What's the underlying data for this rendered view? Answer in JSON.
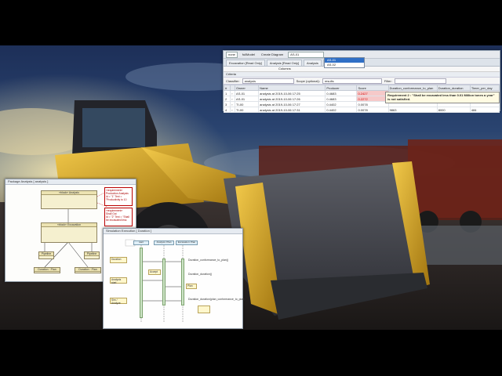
{
  "toolbar": {
    "select_value": "none",
    "label_fullmodel": "fullModel",
    "label_create_diagram": "Create Diagram",
    "search_value": "AS-01",
    "dropdown_items": [
      "AS-01",
      "AS-02"
    ]
  },
  "tabs": [
    {
      "label": "Excavation [Read Only]"
    },
    {
      "label": "Analysis [Read Only]"
    },
    {
      "label": "Analysis"
    },
    {
      "label": "results"
    }
  ],
  "subtoolbar_label": "Columns",
  "section_label": "Criteria",
  "filters": {
    "classifier_label": "Classifier:",
    "classifier_value": "analysis",
    "scope_label": "Scope (optional):",
    "scope_value": "results",
    "filter_label": "Filter:"
  },
  "table": {
    "columns": [
      "#",
      "",
      "Owner",
      "Name",
      "Producer",
      "Score",
      "Duration_conformance_to_plan",
      "Duration_duration",
      "Timer_per_day"
    ],
    "rows": [
      {
        "num": "1",
        "owner": "AS-01",
        "name": "analysis at 2019-10-06 17:25",
        "producer": "0.4683",
        "score": "0.2427",
        "duration_plan": "4993",
        "duration": "5917",
        "timer": "484"
      },
      {
        "num": "2",
        "owner": "AS-01",
        "name": "analysis at 2019-10-06 17:26",
        "producer": "0.4683",
        "score": "0.2272",
        "duration_plan": "",
        "duration": "",
        "timer": ""
      },
      {
        "num": "3",
        "owner": "TI-00",
        "name": "analysis at 2019-10-06 17:27",
        "producer": "0.4402",
        "score": "0.0078",
        "duration_plan": "",
        "duration": "",
        "timer": ""
      },
      {
        "num": "4",
        "owner": "TI-00",
        "name": "analysis at 2019-10-06 17:31",
        "producer": "0.4402",
        "score": "0.0078",
        "duration_plan": "9863",
        "duration": "8000",
        "timer": "484"
      }
    ]
  },
  "requirement_tooltip": "Requirement 2 : \"Shall be excavated less than 0.01 Million tones a year\" is not satisfied.",
  "class_diagram": {
    "title": "Package Analysis [ analysis ]",
    "top_block": {
      "stereotype": "«block»",
      "name": "Analysis"
    },
    "note_top": {
      "title": "«requirement»",
      "name": "Production Analysis",
      "text": "Id = \"1\" Text = \"Productivity to 10 Million tones a year\""
    },
    "note_mid": {
      "title": "«requirement»",
      "name": "Shall Out",
      "text": "Id = \"2\" Text = \"Shall be excavated less than 0.01 Million tones a year\""
    },
    "mid_block": {
      "stereotype": "«block»",
      "name": "Excavation"
    },
    "small_left": "Pipeline",
    "small_right": "Pipeline",
    "bottom_left": "Duration · Plan",
    "bottom_right": "Duration · Plan"
  },
  "sequence_diagram": {
    "title": "Simulation Execution [ Duration ]",
    "lifelines": [
      "start",
      "Analysis: Plan",
      "Excavation: Plan"
    ],
    "left_boxes": [
      "Duration",
      "Analysis start",
      "Sim / Analyze"
    ],
    "messages": [
      "Duration_conformance_to_plan()",
      "Duration_duration()",
      "Accept",
      "Plan",
      "Duration_duration(plan_conformance_to_plan)"
    ]
  },
  "colors": {
    "accent_blue": "#2f6fc6",
    "fail_red": "#c00000",
    "uml_fill": "#f5f0cf"
  }
}
